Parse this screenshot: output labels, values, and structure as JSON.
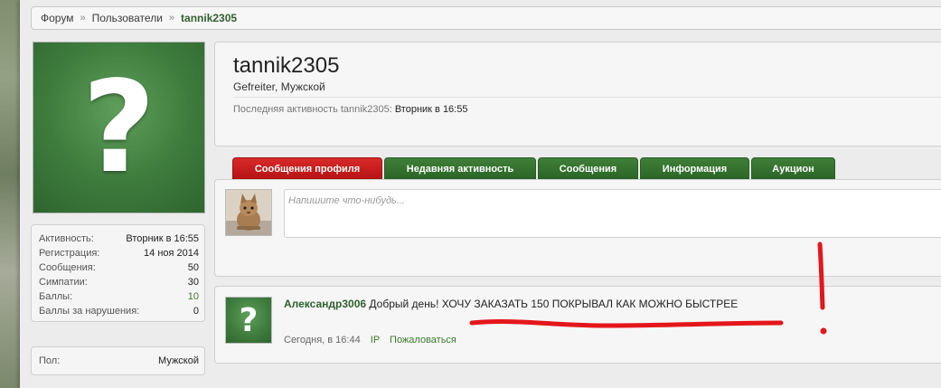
{
  "breadcrumb": {
    "items": [
      "Форум",
      "Пользователи"
    ],
    "separator": "»",
    "current": "tannik2305"
  },
  "profile": {
    "username": "tannik2305",
    "subtitle": "Gefreiter, Мужской",
    "last_activity_label": "Последняя активность tannik2305:",
    "last_activity_value": "Вторник в 16:55"
  },
  "stats": [
    {
      "label": "Активность:",
      "value": "Вторник в 16:55"
    },
    {
      "label": "Регистрация:",
      "value": "14 ноя 2014"
    },
    {
      "label": "Сообщения:",
      "value": "50"
    },
    {
      "label": "Симпатии:",
      "value": "30"
    },
    {
      "label": "Баллы:",
      "value": "10"
    },
    {
      "label": "Баллы за нарушения:",
      "value": "0"
    }
  ],
  "gender": {
    "label": "Пол:",
    "value": "Мужской"
  },
  "tabs": [
    {
      "label": "Сообщения профиля",
      "active": true
    },
    {
      "label": "Недавняя активность",
      "active": false
    },
    {
      "label": "Сообщения",
      "active": false
    },
    {
      "label": "Информация",
      "active": false
    },
    {
      "label": "Аукцион",
      "active": false
    }
  ],
  "composer": {
    "placeholder": "Напишите что-нибудь..."
  },
  "message": {
    "author": "Александр3006",
    "text": "Добрый день! ХОЧУ ЗАКАЗАТЬ 150 ПОКРЫВАЛ КАК МОЖНО БЫСТРЕЕ",
    "time": "Сегодня, в 16:44",
    "ip_label": "IP",
    "report_label": "Пожаловаться"
  },
  "avatar_glyph": "?",
  "colors": {
    "accent_green": "#3b7a2d",
    "tab_green": "#2c6627",
    "tab_active_red": "#c41b1b",
    "annotation_red": "#e4161b"
  },
  "icons": {
    "default_avatar": "question-mark-icon",
    "small_avatar": "cat-icon"
  }
}
